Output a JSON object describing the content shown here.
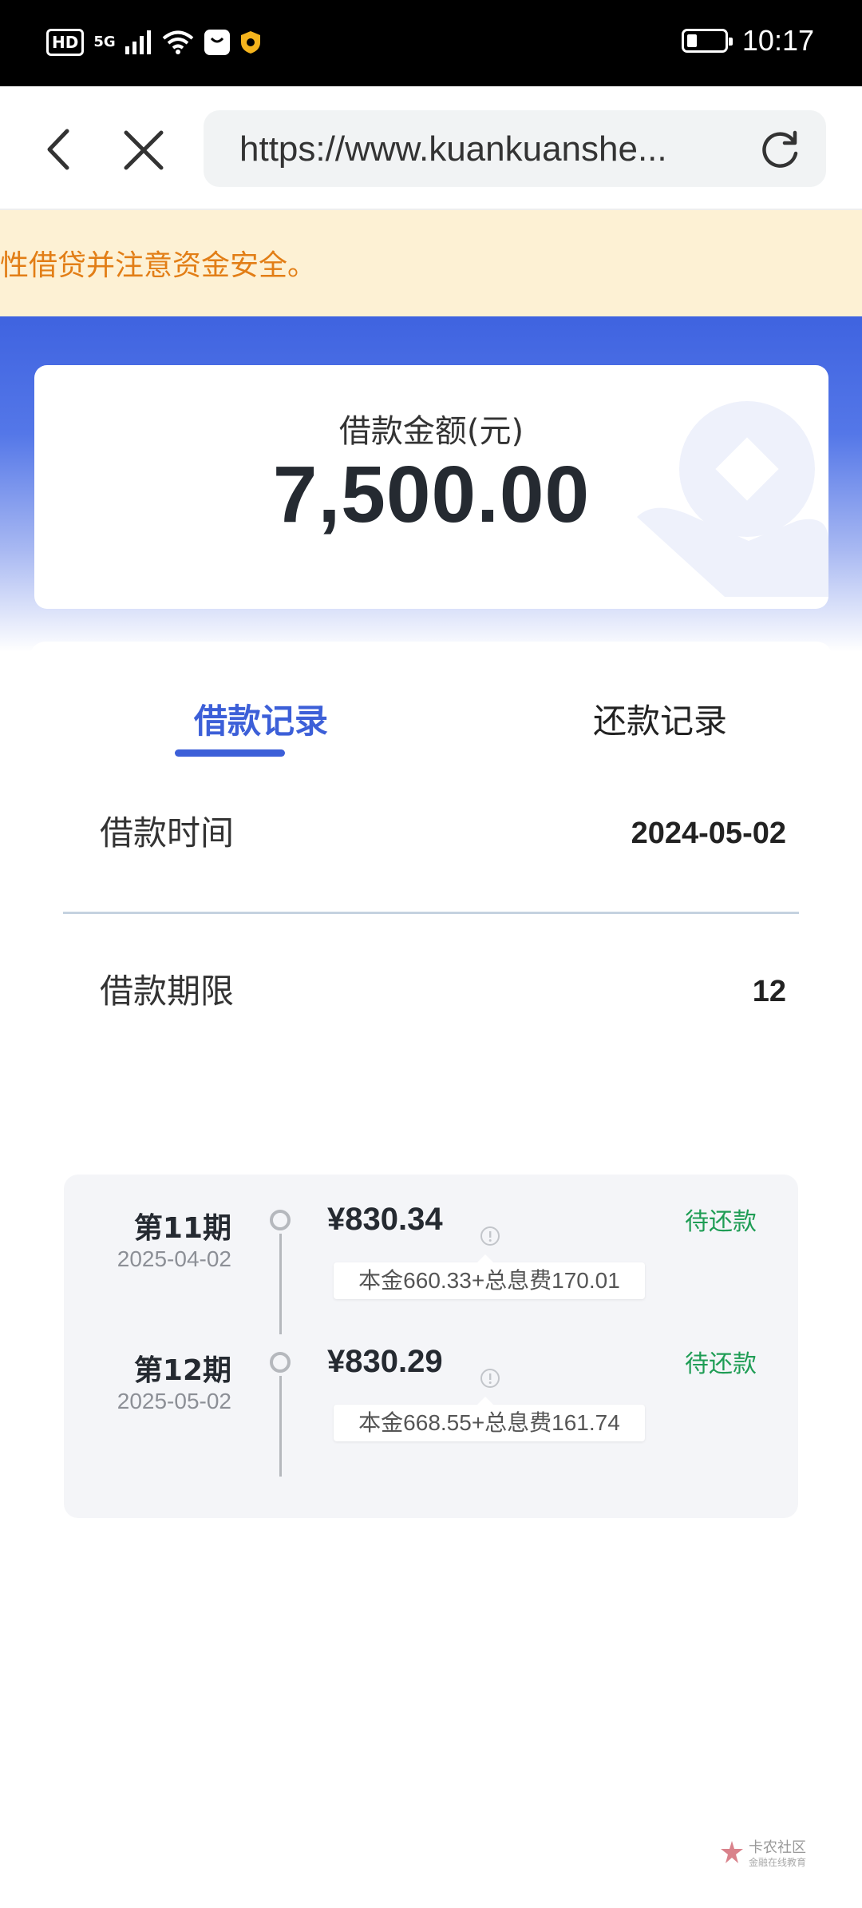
{
  "status_bar": {
    "hd": "HD",
    "network": "5G",
    "time": "10:17"
  },
  "browser": {
    "url": "https://www.kuankuanshe..."
  },
  "notice": {
    "text": "性借贷并注意资金安全。"
  },
  "loan": {
    "amount_label": "借款金额(元)",
    "amount": "7,500.00"
  },
  "tabs": [
    {
      "label": "借款记录",
      "active": true
    },
    {
      "label": "还款记录",
      "active": false
    }
  ],
  "details": {
    "time_label": "借款时间",
    "time_value": "2024-05-02",
    "term_label": "借款期限",
    "term_value": "12"
  },
  "installments": [
    {
      "period": "第11期",
      "date": "2025-04-02",
      "amount": "¥830.34",
      "detail": "本金660.33+总息费170.01",
      "status": "待还款"
    },
    {
      "period": "第12期",
      "date": "2025-05-02",
      "amount": "¥830.29",
      "detail": "本金668.55+总息费161.74",
      "status": "待还款"
    }
  ],
  "watermark": {
    "title": "卡农社区",
    "subtitle": "金融在线教育"
  },
  "colors": {
    "accent": "#3c5fd8",
    "notice_text": "#e27e16",
    "notice_bg": "#fdf1d4",
    "status_green": "#1f9d55"
  }
}
